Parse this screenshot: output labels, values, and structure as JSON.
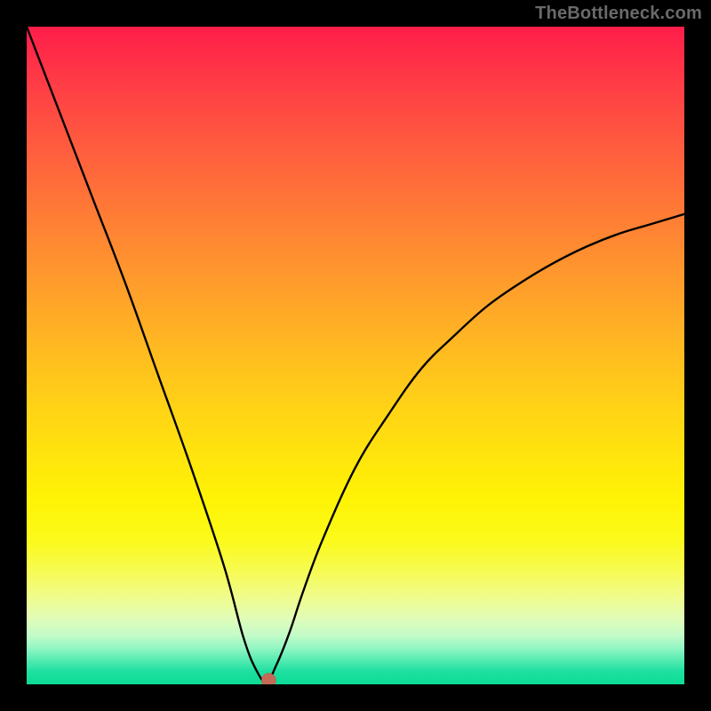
{
  "watermark": "TheBottleneck.com",
  "chart_data": {
    "type": "line",
    "title": "",
    "xlabel": "",
    "ylabel": "",
    "xlim": [
      0,
      100
    ],
    "ylim": [
      0,
      100
    ],
    "background": "heat-gradient",
    "grid": false,
    "series": [
      {
        "name": "bottleneck-curve",
        "x": [
          0,
          5,
          10,
          15,
          20,
          25,
          30,
          33,
          35,
          36.5,
          38,
          40,
          42,
          45,
          50,
          55,
          60,
          65,
          70,
          75,
          80,
          85,
          90,
          95,
          100
        ],
        "values": [
          100,
          87,
          74,
          61,
          47,
          33,
          18,
          7,
          2,
          0.4,
          3,
          8,
          14,
          22,
          33,
          41,
          48,
          53,
          57.5,
          61,
          64,
          66.5,
          68.5,
          70,
          71.5
        ]
      }
    ],
    "marker": {
      "x": 36.8,
      "y": 0.6,
      "color": "#c56a56",
      "radius_px": 8
    },
    "gradient_stops": [
      {
        "pos": 0,
        "color": "#ff1d4a"
      },
      {
        "pos": 0.28,
        "color": "#ff7a36"
      },
      {
        "pos": 0.58,
        "color": "#ffd316"
      },
      {
        "pos": 0.78,
        "color": "#fbfa1a"
      },
      {
        "pos": 0.93,
        "color": "#92f6c3"
      },
      {
        "pos": 1.0,
        "color": "#0bdc94"
      }
    ]
  }
}
